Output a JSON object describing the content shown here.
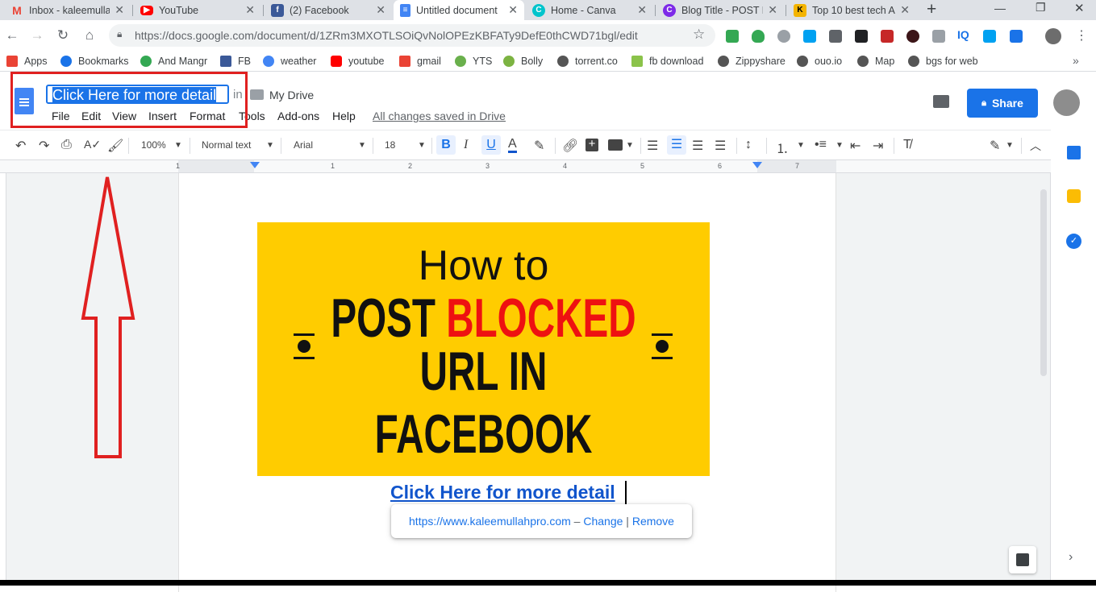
{
  "tabs": [
    {
      "title": "Inbox - kaleemulla",
      "icon": "gmail-icon",
      "color": "#ea4335"
    },
    {
      "title": "YouTube",
      "icon": "youtube-icon",
      "color": "#ff0000"
    },
    {
      "title": "(2) Facebook",
      "icon": "facebook-icon",
      "color": "#3b5998"
    },
    {
      "title": "Untitled document",
      "icon": "docs-icon",
      "color": "#4285f4",
      "active": true
    },
    {
      "title": "Home - Canva",
      "icon": "canva-icon",
      "color": "#00c4cc"
    },
    {
      "title": "Blog Title - POST B",
      "icon": "canva-icon",
      "color": "#7d2ae8"
    },
    {
      "title": "Top 10 best tech A",
      "icon": "k-icon",
      "color": "#f4b400"
    }
  ],
  "address": {
    "url": "https://docs.google.com/document/d/1ZRm3MXOTLSOiQvNolOPEzKBFATy9DefE0thCWD71bgl/edit"
  },
  "bookmarks": [
    {
      "label": "Apps",
      "color": "#ea4335"
    },
    {
      "label": "Bookmarks",
      "color": "#1a73e8"
    },
    {
      "label": "And Mangr",
      "color": "#34a853"
    },
    {
      "label": "FB",
      "color": "#3b5998"
    },
    {
      "label": "weather",
      "color": "#4285f4"
    },
    {
      "label": "youtube",
      "color": "#ff0000"
    },
    {
      "label": "gmail",
      "color": "#ea4335"
    },
    {
      "label": "YTS",
      "color": "#6ab04c"
    },
    {
      "label": "Bolly",
      "color": "#7cb342"
    },
    {
      "label": "torrent.co",
      "color": "#555555"
    },
    {
      "label": "fb download",
      "color": "#8bc34a"
    },
    {
      "label": "Zippyshare",
      "color": "#555555"
    },
    {
      "label": "ouo.io",
      "color": "#555555"
    },
    {
      "label": "Map",
      "color": "#555555"
    },
    {
      "label": "bgs for web",
      "color": "#555555"
    }
  ],
  "doc": {
    "title": "Click Here for more detail",
    "in": "in",
    "folder": "My Drive",
    "menus": [
      "File",
      "Edit",
      "View",
      "Insert",
      "Format",
      "Tools",
      "Add-ons",
      "Help"
    ],
    "saved": "All changes saved in Drive",
    "share": "Share"
  },
  "toolbar": {
    "zoom": "100%",
    "style": "Normal text",
    "font": "Arial",
    "size": "18"
  },
  "ruler": [
    "1",
    "1",
    "2",
    "3",
    "4",
    "5",
    "6",
    "7"
  ],
  "banner": {
    "line1": "How to",
    "line2a": "POST ",
    "line2b": "BLOCKED",
    "line3": "URL IN FACEBOOK",
    "bg": "#ffcc00",
    "accent": "#ee1111"
  },
  "link": {
    "text": "Click Here for more detail",
    "url": "https://www.kaleemullahpro.com",
    "sep": " – ",
    "change": "Change",
    "bar": " | ",
    "remove": "Remove"
  }
}
